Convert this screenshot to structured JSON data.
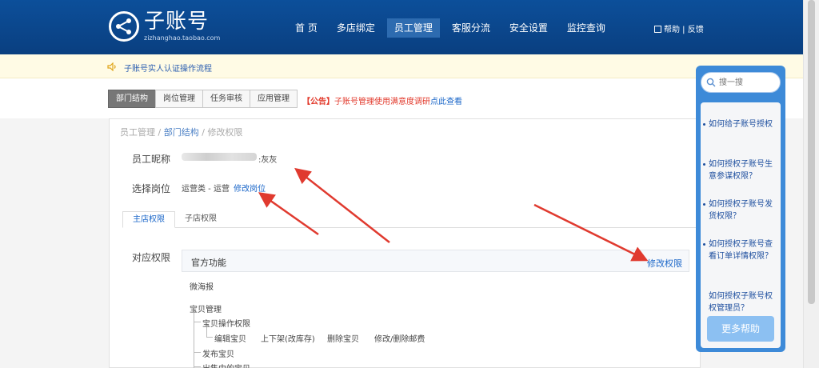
{
  "header": {
    "logo_title": "子账号",
    "logo_sub": "zizhanghao.taobao.com",
    "nav": [
      "首 页",
      "多店绑定",
      "员工管理",
      "客服分流",
      "安全设置",
      "监控查询"
    ],
    "help_label": "帮助",
    "feedback_label": "反馈"
  },
  "notice": {
    "text": "子账号实人认证操作流程"
  },
  "subtabs": [
    "部门结构",
    "岗位管理",
    "任务审核",
    "应用管理"
  ],
  "announcement": {
    "tag": "【公告】",
    "body": "子账号管理使用满意度调研",
    "link": "点此查看"
  },
  "breadcrumb": {
    "a": "员工管理",
    "b": "部门结构",
    "c": "修改权限",
    "sep": "/"
  },
  "form": {
    "nickname_label": "员工昵称",
    "nickname_suffix": ":灰灰",
    "position_label": "选择岗位",
    "position_value": "运营类 - 运营",
    "edit_position": "修改岗位",
    "perm_tabs": [
      "主店权限",
      "子店权限"
    ],
    "perm_label": "对应权限",
    "func_title": "官方功能",
    "edit_perm": "修改权限",
    "tree": {
      "weihaibao": "微海报",
      "baobei_mgmt": "宝贝管理",
      "baobei_ops": "宝贝操作权限",
      "ops": [
        "编辑宝贝",
        "上下架(改库存)",
        "删除宝贝",
        "修改/删除邮费"
      ],
      "publish": "发布宝贝",
      "selling": "出售中的宝贝"
    }
  },
  "side": {
    "search_placeholder": "搜一搜",
    "faqs": [
      "如何给子账号授权",
      "如何授权子账号生意参谋权限？",
      "如何授权子账号发货权限？",
      "如何授权子账号查看订单详情权限？",
      "如何授权子账号权权管理员？"
    ],
    "more_help": "更多帮助"
  },
  "colors": {
    "header": "#0c4f9a",
    "accent": "#1a66c8",
    "arrow": "#e03a2f",
    "notice_bg": "#fffbe5"
  }
}
